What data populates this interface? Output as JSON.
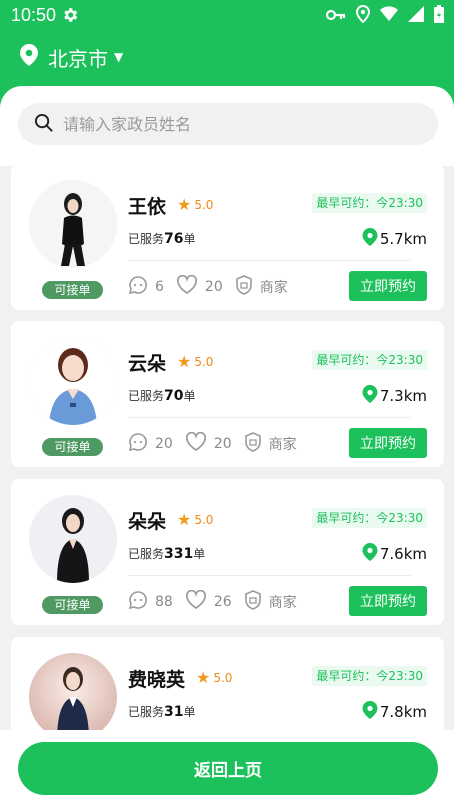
{
  "status_bar": {
    "time": "10:50"
  },
  "location": {
    "city": "北京市"
  },
  "search": {
    "placeholder": "请输入家政员姓名"
  },
  "cards": [
    {
      "name": "王依",
      "rating": "5.0",
      "available": "最早可约：今23:30",
      "served_prefix": "已服务",
      "served_count": "76",
      "served_suffix": "单",
      "distance": "5.7km",
      "comments": "6",
      "likes": "20",
      "merchant": "商家",
      "book": "立即预约",
      "badge": "可接单"
    },
    {
      "name": "云朵",
      "rating": "5.0",
      "available": "最早可约：今23:30",
      "served_prefix": "已服务",
      "served_count": "70",
      "served_suffix": "单",
      "distance": "7.3km",
      "comments": "20",
      "likes": "20",
      "merchant": "商家",
      "book": "立即预约",
      "badge": "可接单"
    },
    {
      "name": "朵朵",
      "rating": "5.0",
      "available": "最早可约：今23:30",
      "served_prefix": "已服务",
      "served_count": "331",
      "served_suffix": "单",
      "distance": "7.6km",
      "comments": "88",
      "likes": "26",
      "merchant": "商家",
      "book": "立即预约",
      "badge": "可接单"
    },
    {
      "name": "费晓英",
      "rating": "5.0",
      "available": "最早可约：今23:30",
      "served_prefix": "已服务",
      "served_count": "31",
      "served_suffix": "单",
      "distance": "7.8km"
    }
  ],
  "footer": {
    "back_label": "返回上页"
  },
  "colors": {
    "brand": "#1cc15b",
    "badge": "#4f9a63",
    "star": "#f29a1c",
    "avail_bg": "#eafaf0"
  }
}
